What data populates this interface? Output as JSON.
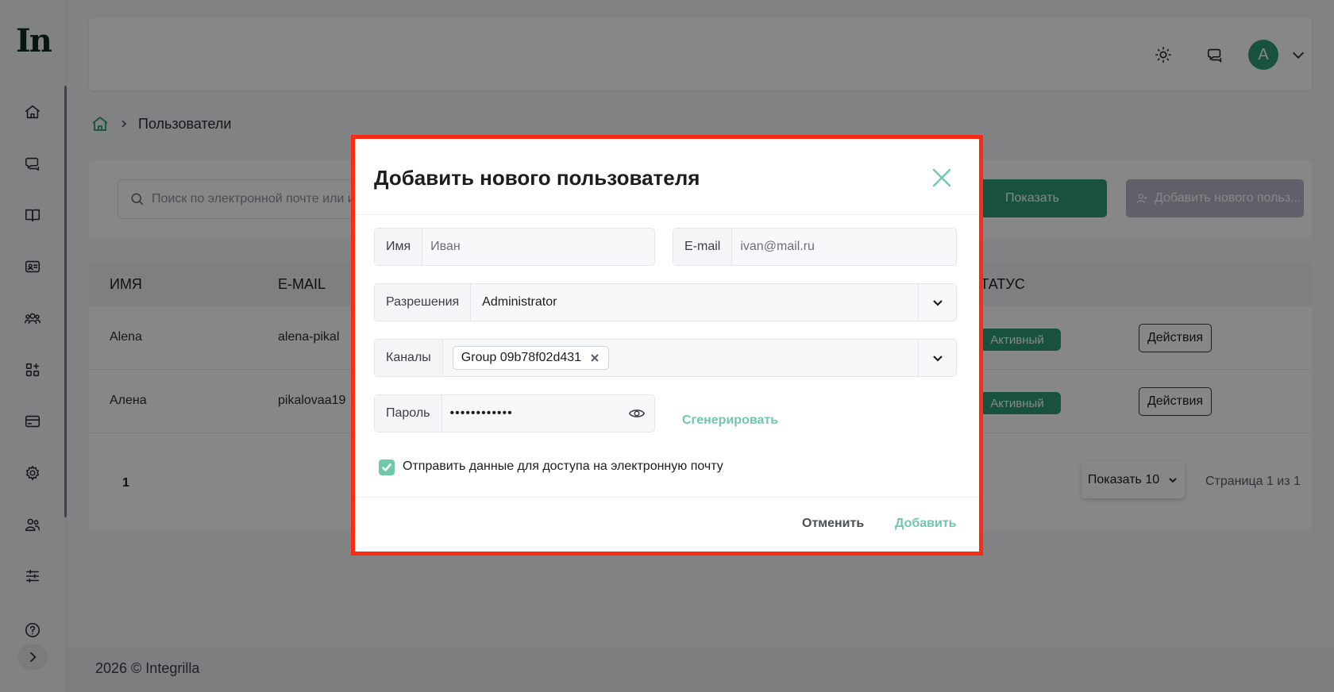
{
  "app": {
    "logo_text": "In",
    "footer": "2026 © Integrilla"
  },
  "header": {
    "avatar_letter": "A"
  },
  "breadcrumb": {
    "current": "Пользователи"
  },
  "toolbar": {
    "search_placeholder": "Поиск по электронной почте или и",
    "show_label": "Показать",
    "add_user_label": "Добавить нового польз..."
  },
  "table": {
    "columns": [
      "ИМЯ",
      "E-MAIL",
      "СТАТУС"
    ],
    "rows": [
      {
        "name": "Alena",
        "email": "alena-pikal",
        "status": "Активный",
        "action": "Действия"
      },
      {
        "name": "Алена",
        "email": "pikalovaa19",
        "status": "Активный",
        "action": "Действия"
      }
    ],
    "page_number": "1",
    "per_page": "Показать 10",
    "page_info": "Страница 1 из 1"
  },
  "modal": {
    "title": "Добавить нового пользователя",
    "name": {
      "label": "Имя",
      "placeholder": "Иван"
    },
    "email": {
      "label": "E-mail",
      "placeholder": "ivan@mail.ru"
    },
    "permissions": {
      "label": "Разрешения",
      "value": "Administrator"
    },
    "channels": {
      "label": "Каналы",
      "chips": [
        "Group 09b78f02d431"
      ]
    },
    "password": {
      "label": "Пароль",
      "value": "••••••••••••"
    },
    "generate_label": "Сгенерировать",
    "send_checkbox": {
      "checked": true,
      "label": "Отправить данные для доступа на электронную почту"
    },
    "cancel_label": "Отменить",
    "submit_label": "Добавить"
  },
  "colors": {
    "accent": "#6fc9a8",
    "brand": "#2e9a73",
    "highlight_border": "#ff2a14"
  }
}
